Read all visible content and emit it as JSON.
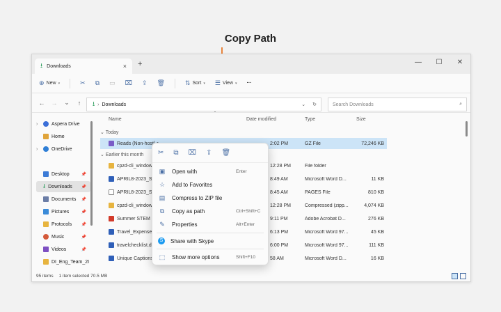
{
  "caption": "Copy Path",
  "window": {
    "tab_title": "Downloads",
    "tab_close": "×",
    "new_tab": "+",
    "controls": [
      "—",
      "☐",
      "✕"
    ]
  },
  "toolbar": {
    "new": "New",
    "sort": "Sort",
    "view": "View",
    "more": "···"
  },
  "address": {
    "path": "Downloads",
    "search_placeholder": "Search Downloads"
  },
  "sidebar": {
    "items": [
      {
        "label": "Aspera Drive",
        "color": "#3b6fd8"
      },
      {
        "label": "Home",
        "color": "#e0a43a"
      },
      {
        "label": "OneDrive",
        "color": "#2f7fd6"
      },
      {
        "label": "Desktop",
        "color": "#3c7bd6"
      },
      {
        "label": "Downloads",
        "color": "#2b9c5c"
      },
      {
        "label": "Documents",
        "color": "#6b7da6"
      },
      {
        "label": "Pictures",
        "color": "#3b8bd8"
      },
      {
        "label": "Protocols",
        "color": "#e7b43f"
      },
      {
        "label": "Music",
        "color": "#d45a3a"
      },
      {
        "label": "Videos",
        "color": "#7d4fc2"
      },
      {
        "label": "DI_Eng_Team_2I",
        "color": "#e7b43f"
      }
    ]
  },
  "columns": {
    "name": "Name",
    "date": "Date modified",
    "type": "Type",
    "size": "Size"
  },
  "groups": {
    "today": "Today",
    "earlier": "Earlier this month"
  },
  "files": [
    {
      "name": "Reads (Non-host).r",
      "date": "2:02 PM",
      "type": "GZ File",
      "size": "72,246 KB",
      "color": "#7a5cc7"
    },
    {
      "name": "cpzd-cli_windows_i",
      "date": "12:28 PM",
      "type": "File folder",
      "size": "",
      "color": "#e7b43f"
    },
    {
      "name": "APRIL8-2023_Seal",
      "date": "8:49 AM",
      "type": "Microsoft Word D...",
      "size": "11 KB",
      "color": "#2f5fb8"
    },
    {
      "name": "APRIL8-2023_Seal",
      "date": "8:45 AM",
      "type": "PAGES File",
      "size": "810 KB",
      "color": "#888888"
    },
    {
      "name": "cpzd-cli_windows_i",
      "date": "12:28 PM",
      "type": "Compressed (zipp...",
      "size": "4,074 KB",
      "color": "#e7b43f"
    },
    {
      "name": "Summer STEM Cer",
      "date": "9:11 PM",
      "type": "Adobe Acrobat D...",
      "size": "276 KB",
      "color": "#d23a2a"
    },
    {
      "name": "Travel_Expense_Re",
      "date": "6:13 PM",
      "type": "Microsoft Word 97...",
      "size": "45 KB",
      "color": "#2f5fb8"
    },
    {
      "name": "travelchecklist.doc",
      "date": "6:00 PM",
      "type": "Microsoft Word 97...",
      "size": "111 KB",
      "color": "#2f5fb8"
    },
    {
      "name": "Unique Captions ti",
      "date": "58 AM",
      "type": "Microsoft Word D...",
      "size": "16 KB",
      "color": "#2f5fb8"
    }
  ],
  "status": {
    "items": "95 items",
    "selected": "1 item selected  70.5 MB"
  },
  "context_menu": {
    "items": [
      {
        "label": "Open with",
        "shortcut": "Enter",
        "icon": "open-with-icon",
        "glyph": "▣"
      },
      {
        "label": "Add to Favorites",
        "shortcut": "",
        "icon": "star-icon",
        "glyph": "☆"
      },
      {
        "label": "Compress to ZIP file",
        "shortcut": "",
        "icon": "zip-icon",
        "glyph": "▤"
      },
      {
        "label": "Copy as path",
        "shortcut": "Ctrl+Shift+C",
        "icon": "copy-path-icon",
        "glyph": "⧉"
      },
      {
        "label": "Properties",
        "shortcut": "Alt+Enter",
        "icon": "wrench-icon",
        "glyph": "✎"
      },
      {
        "label": "Share with Skype",
        "shortcut": "",
        "icon": "skype-icon",
        "glyph": "S"
      },
      {
        "label": "Show more options",
        "shortcut": "Shift+F10",
        "icon": "more-options-icon",
        "glyph": "⬚"
      }
    ]
  }
}
